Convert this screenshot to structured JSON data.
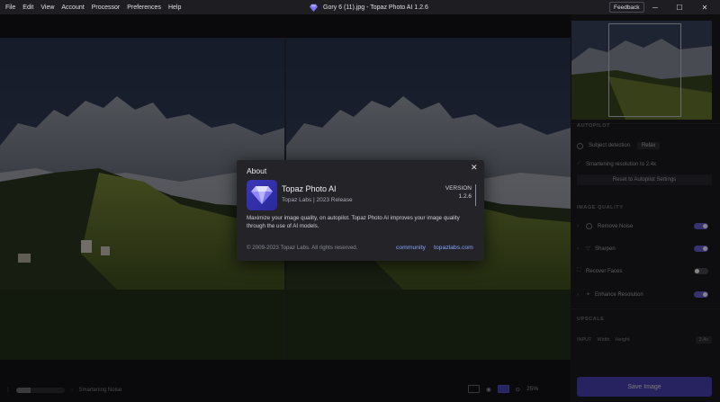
{
  "menu": [
    "File",
    "Edit",
    "View",
    "Account",
    "Processor",
    "Preferences",
    "Help"
  ],
  "window": {
    "title": "Gory 6 (11).jpg - Topaz Photo AI 1.2.6",
    "feedback": "Feedback",
    "minimize": "─",
    "maximize": "☐",
    "close": "✕"
  },
  "panel": {
    "autopilot": "AUTOPILOT",
    "subject_detection": "Subject detection",
    "subject_value": "Relax",
    "smartening": "Smartening resolution to 2.4x",
    "reset_button": "Reset to Autopilot Settings",
    "image_quality": "IMAGE QUALITY",
    "remove_noise": "Remove Noise",
    "sharpen": "Sharpen",
    "recover_faces": "Recover Faces",
    "enhance_resolution": "Enhance Resolution",
    "upscale": "UPSCALE",
    "input_label": "INPUT",
    "input_width": "Width",
    "input_height": "Height",
    "scale": "2.4x",
    "save_button": "Save Image"
  },
  "status": {
    "text": "Smartening Noise",
    "progress": 0.3,
    "zoom": "25%"
  },
  "about": {
    "title": "About",
    "product": "Topaz Photo AI",
    "company": "Topaz Labs | 2023 Release",
    "version_label": "VERSION",
    "version": "1.2.6",
    "description": "Maximize your image quality, on autopilot. Topaz Photo AI improves your image quality through the use of AI models.",
    "copyright": "© 2009-2023 Topaz Labs. All rights reserved.",
    "link_community": "community",
    "link_site": "topazlabs.com"
  },
  "colors": {
    "accent": "#4b46c0",
    "link": "#8aa6ff",
    "logo": "#3a37b8"
  }
}
